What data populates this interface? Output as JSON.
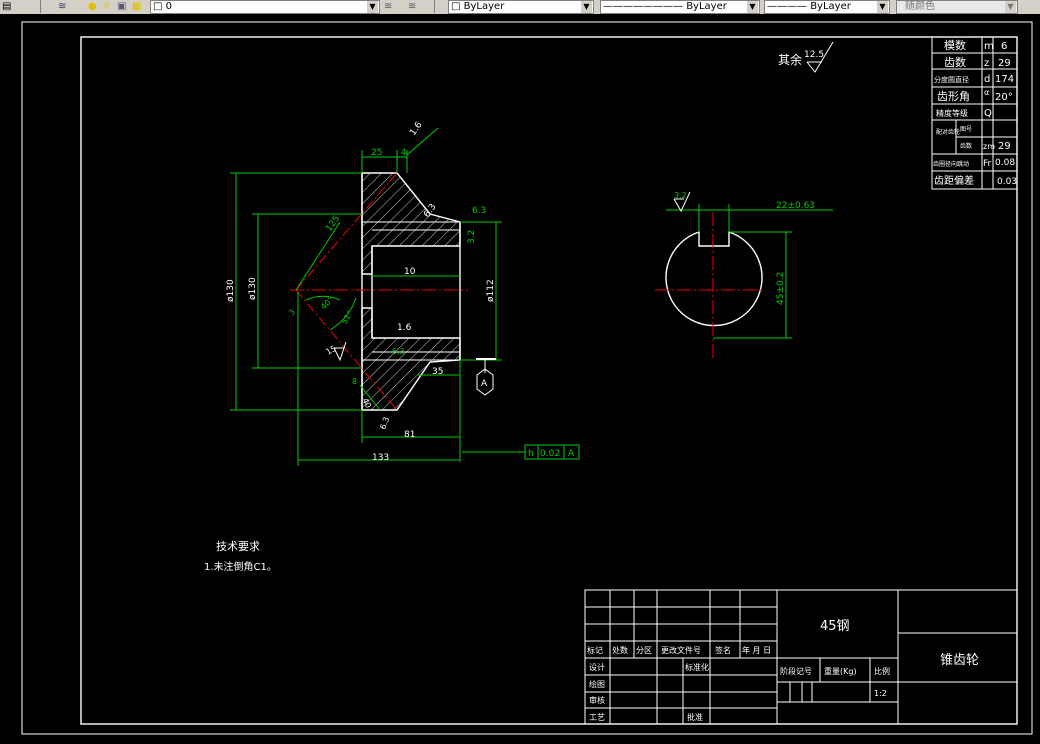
{
  "toolbar": {
    "layer_name": "0",
    "color": "ByLayer",
    "linetype": "ByLayer",
    "lineweight": "ByLayer",
    "plotstyle": "随颜色"
  },
  "drawing": {
    "roughness_prefix": "其余",
    "roughness_main": "12.5",
    "params": [
      {
        "label": "模数",
        "sym": "m",
        "val": "6"
      },
      {
        "label": "齿数",
        "sym": "z",
        "val": "29"
      },
      {
        "label": "分度圆直径",
        "sym": "d",
        "val": "174"
      },
      {
        "label": "齿形角",
        "sym": "α",
        "val": "20°"
      },
      {
        "label": "精度等级",
        "sym": "Q",
        "val": ""
      },
      {
        "label_a": "配对齿轮",
        "label_b": "图号",
        "sym": "",
        "val": ""
      },
      {
        "label_b": "齿数",
        "sym": "zm",
        "val": "29"
      },
      {
        "label": "齿圈径向跳动",
        "sym": "Fr",
        "val": "0.08"
      },
      {
        "label": "齿距偏差",
        "sym": "",
        "val": "0.03"
      }
    ],
    "dims": {
      "d25": "25",
      "d4": "4",
      "d16a": "1.6",
      "d125": "125",
      "d63a": "6.3",
      "d32": "3.2",
      "d63b": "6.3",
      "d10": "10",
      "phi130a": "ø130",
      "phi130b": "ø130",
      "phi112": "ø112",
      "a40": "40°",
      "a51": "51°",
      "d3": "3",
      "d16b": "1.6",
      "d15": "15",
      "d63c": "6.3",
      "d35": "35",
      "d8": "8",
      "d40": "40",
      "d63d": "6.3",
      "d81": "81",
      "d133": "133",
      "datum": "A"
    },
    "tolerance_frame": {
      "sym": "h",
      "val": "0.02",
      "datum": "A"
    },
    "side": {
      "rough": "3.2",
      "width": "22±0.63",
      "height": "45±0.2"
    },
    "tech_title": "技术要求",
    "tech_item": "1.未注倒角C1。",
    "title_block": {
      "material": "45钢",
      "name": "锥齿轮",
      "headers": [
        "标记",
        "处数",
        "分区",
        "更改文件号",
        "签名",
        "年 月 日"
      ],
      "rows": [
        "设计",
        "绘图",
        "审核",
        "工艺"
      ],
      "std": "标准化",
      "approve": "批准",
      "stage": "阶段记号",
      "weight": "重量(Kg)",
      "scale_label": "比例",
      "scale": "1:2"
    }
  }
}
